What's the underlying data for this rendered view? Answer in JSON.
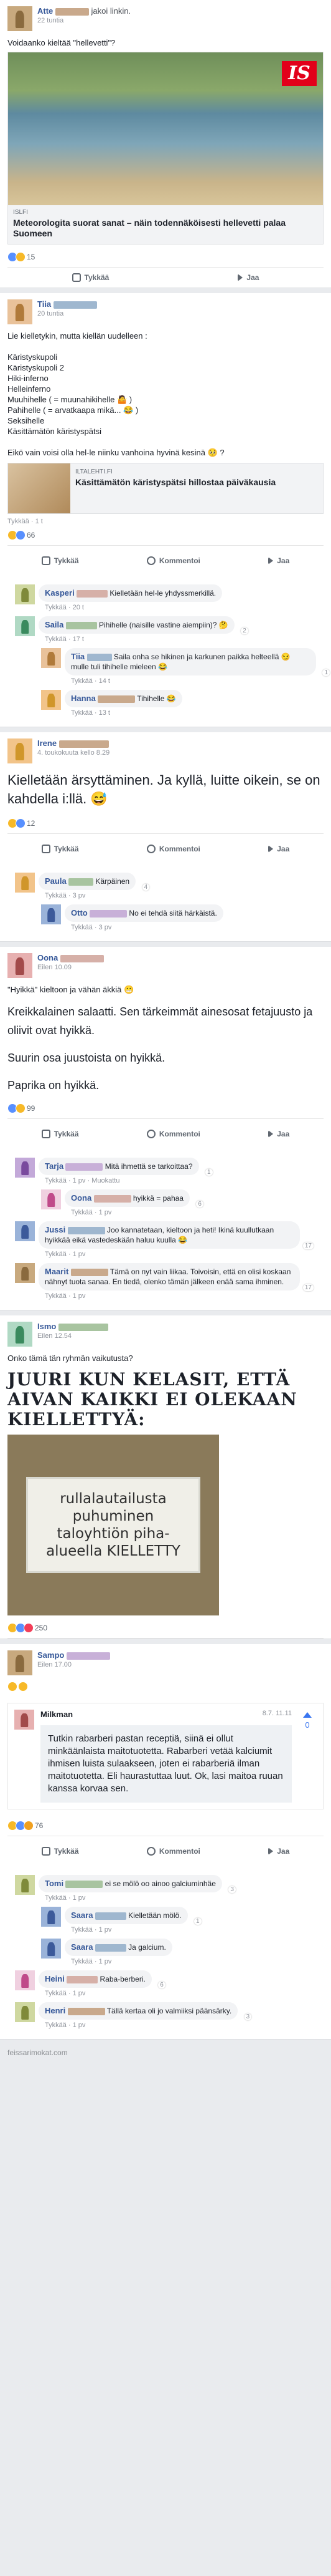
{
  "posts": {
    "p1": {
      "author": "Atte",
      "action": "jakoi linkin.",
      "time": "22 tuntia",
      "text": "Voidaanko kieltää \"hellevetti\"?",
      "link_site": "ISLFI",
      "link_badge": "IS",
      "link_title": "Meteorologita suorat sanat – näin todennäköisesti hellevetti palaa Suomeen",
      "reactions": "15"
    },
    "p2": {
      "author": "Tiia",
      "time": "20 tuntia",
      "text": "Lie kielletykin, mutta kiellän uudelleen :\n\nKäristyskupoli\nKäristyskupoli 2\nHiki-inferno\nHelleinferno\nMuuhihelle ( = muunahikihelle 🤷 )\nPahihelle ( = arvatkaapa mikä... 😂 )\nSeksihelle\nKäsittämätön käristyspätsi\n\nEikö vain voisi olla hel-le niinku vanhoina hyvinä kesinä 🥺 ?",
      "card_site": "ILTALEHTI.FI",
      "card_title": "Käsittämätön käristyspätsi hillostaa päiväkausia",
      "like_time": "Tykkää · 1 t",
      "reactions": "66"
    },
    "p3": {
      "author": "Irene",
      "time": "4. toukokuuta kello 8.29",
      "text": "Kielletään ärsyttäminen. Ja kyllä, luitte oikein, se on kahdella i:llä. 😅",
      "reactions": "12"
    },
    "p4": {
      "author": "Oona",
      "time": "Eilen 10.09",
      "text": "\"Hyikkä\" kieltoon ja vähän äkkiä 😬",
      "article": [
        "Kreikkalainen salaatti. Sen tärkeimmät ainesosat fetajuusto ja oliivit ovat hyikkä.",
        "Suurin osa juustoista on hyikkä.",
        "Paprika on hyikkä."
      ],
      "reactions": "99"
    },
    "p5": {
      "author": "Ismo",
      "time": "Eilen 12.54",
      "text": "Onko tämä tän ryhmän vaikutusta?",
      "meme_title": "JUURI KUN KELASIT, ETTÄ AIVAN KAIKKI EI OLEKAAN KIELLETTYÄ:",
      "sign_text": "rullalautailusta puhuminen taloyhtiön piha-alueella KIELLETTY",
      "reactions": "250"
    },
    "p6": {
      "author": "Sampo",
      "time": "Eilen 17.00",
      "quote_name": "Milkman",
      "quote_date": "8.7. 11.11",
      "quote_text": "Tutkin rabarberi pastan receptiä, siinä ei ollut minkäänlaista maitotuotetta. Rabarberi vetää kalciumit ihmisen luista sulaakseen, joten ei rabarberiä ilman maitotuotetta. Eli haurastuttaa luut. Ok, lasi maitoa ruuan kanssa korvaa sen.",
      "quote_votes": "0",
      "reactions": "76"
    }
  },
  "actions": {
    "like": "Tykkää",
    "comment": "Kommentoi",
    "share": "Jaa"
  },
  "comments": {
    "p2": [
      {
        "name": "Kasperi",
        "text": "Kielletään hel-le yhdyssmerkillä.",
        "meta": "Tykkää · 20 t",
        "level": 0
      },
      {
        "name": "Saila",
        "text": "Pihihelle (naisille vastine aiempiin)? 🤔",
        "meta": "Tykkää · 17 t",
        "level": 0,
        "count": "2"
      },
      {
        "name": "Tiia",
        "text": "Saila onha se hikinen ja karkunen paikka helteellä 😏 mulle tuli tihihelle mieleen 😂",
        "meta": "Tykkää · 14 t",
        "level": 1,
        "count": "1"
      },
      {
        "name": "Hanna",
        "text": "Tihihelle 😂",
        "meta": "Tykkää · 13 t",
        "level": 1
      }
    ],
    "p3": [
      {
        "name": "Paula",
        "text": "Kärpäinen",
        "meta": "Tykkää · 3 pv",
        "level": 0,
        "count": "4"
      },
      {
        "name": "Otto",
        "text": "No ei tehdä siitä härkäistä.",
        "meta": "Tykkää · 3 pv",
        "level": 1
      }
    ],
    "p4": [
      {
        "name": "Tarja",
        "text": "Mitä ihmettä se tarkoittaa?",
        "meta": "Tykkää · 1 pv · Muokattu",
        "level": 0,
        "count": "1"
      },
      {
        "name": "Oona",
        "text": "hyikkä = pahaa",
        "meta": "Tykkää · 1 pv",
        "level": 1,
        "count": "6"
      },
      {
        "name": "Jussi",
        "text": "Joo kannatetaan, kieltoon ja heti! Ikinä kuullutkaan hyikkää eikä vastedeskään haluu kuulla 😂",
        "meta": "Tykkää · 1 pv",
        "level": 0,
        "count": "17"
      },
      {
        "name": "Maarit",
        "text": "Tämä on nyt vain liikaa. Toivoisin, että en olisi koskaan nähnyt tuota sanaa. En tiedä, olenko tämän jälkeen enää sama ihminen.",
        "meta": "Tykkää · 1 pv",
        "level": 0,
        "count": "17"
      }
    ],
    "p6": [
      {
        "name": "Tomi",
        "text": "ei se mölö oo ainoo galciuminhäe",
        "meta": "Tykkää · 1 pv",
        "level": 0,
        "count": "3"
      },
      {
        "name": "Saara",
        "text": "Kielletään mölö.",
        "meta": "Tykkää · 1 pv",
        "level": 1,
        "count": "1"
      },
      {
        "name": "Saara",
        "text": "Ja galcium.",
        "meta": "Tykkää · 1 pv",
        "level": 1
      },
      {
        "name": "Heini",
        "text": "Raba-berberi.",
        "meta": "Tykkää · 1 pv",
        "level": 0,
        "count": "6"
      },
      {
        "name": "Henri",
        "text": "Tällä kertaa oli jo valmiiksi päänsärky.",
        "meta": "Tykkää · 1 pv",
        "level": 0,
        "count": "3"
      }
    ]
  },
  "footer": "feissarimokat.com"
}
